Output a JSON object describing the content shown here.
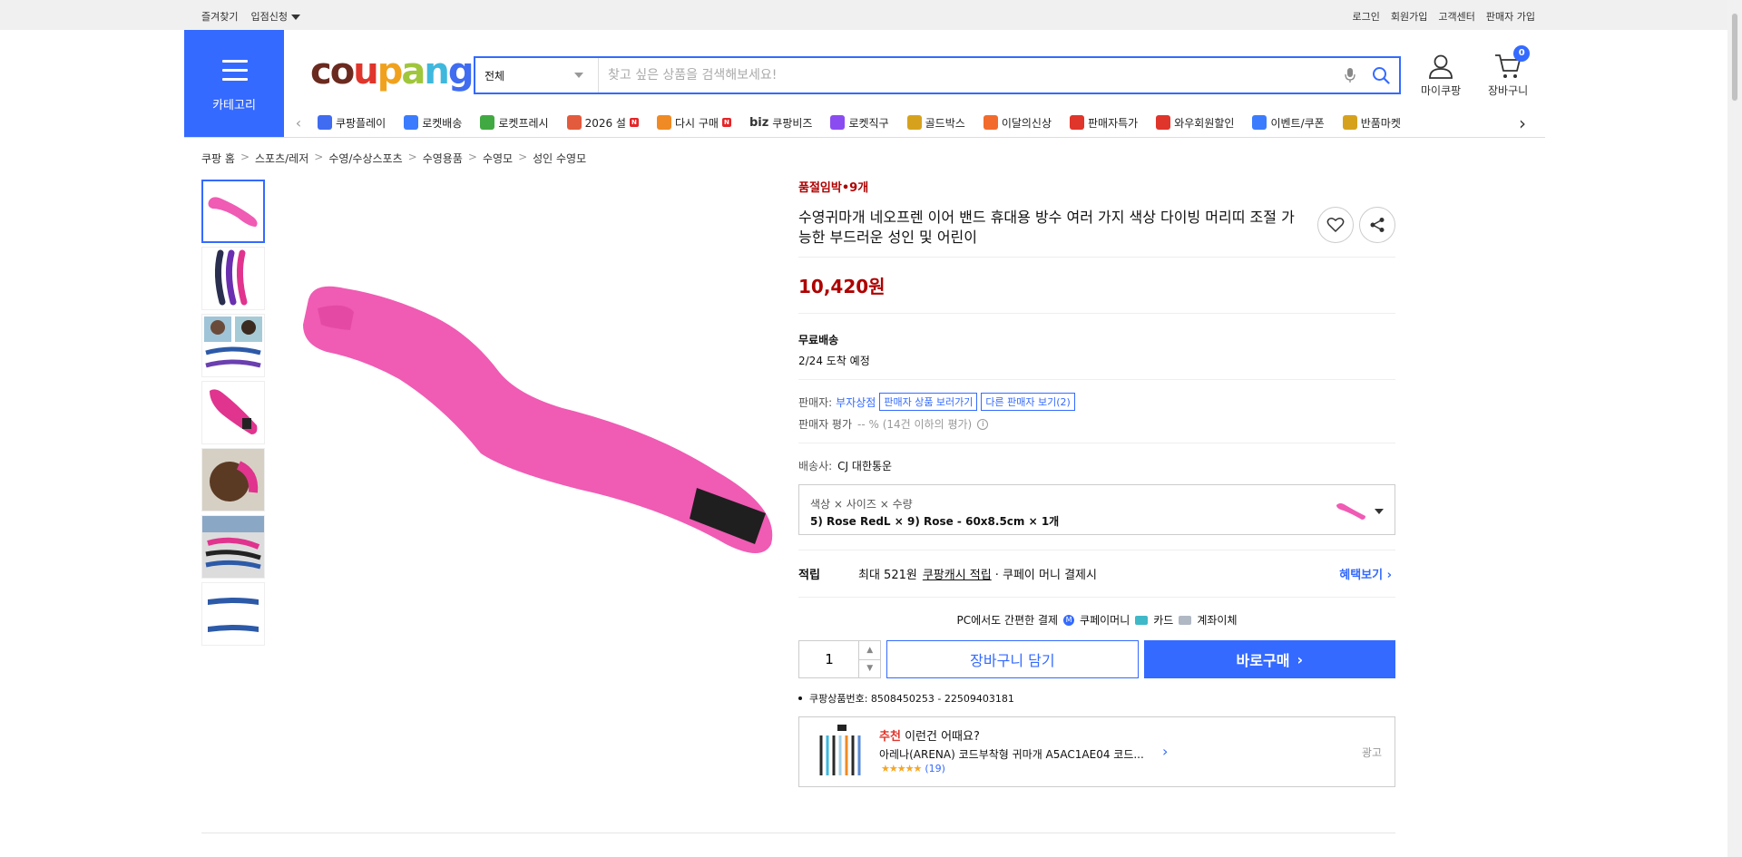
{
  "topbar": {
    "favorites": "즐겨찾기",
    "partner": "입점신청",
    "login": "로그인",
    "signup": "회원가입",
    "customer_center": "고객센터",
    "seller_signup": "판매자 가입"
  },
  "header": {
    "category_label": "카테고리",
    "logo_text": "coupang",
    "search_category": "전체",
    "search_placeholder": "찾고 싶은 상품을 검색해보세요!",
    "my_coupang": "마이쿠팡",
    "cart": "장바구니",
    "cart_count": "0"
  },
  "nav": [
    {
      "label": "쿠팡플레이",
      "color": "#3f6cf0"
    },
    {
      "label": "로켓배송",
      "color": "#3b7cff"
    },
    {
      "label": "로켓프레시",
      "color": "#41a941"
    },
    {
      "label": "2026 설",
      "color": "#e25b3c",
      "badge": "N"
    },
    {
      "label": "다시 구매",
      "color": "#f08a24",
      "badge": "N"
    },
    {
      "label": "쿠팡비즈",
      "prefix": "biz",
      "color": "#333333"
    },
    {
      "label": "로켓직구",
      "color": "#8a4cf0"
    },
    {
      "label": "골드박스",
      "color": "#d6a21e"
    },
    {
      "label": "이달의신상",
      "color": "#f26b2c"
    },
    {
      "label": "판매자특가",
      "color": "#e0352b"
    },
    {
      "label": "와우회원할인",
      "color": "#e0352b"
    },
    {
      "label": "이벤트/쿠폰",
      "color": "#3b7cff"
    },
    {
      "label": "반품마켓",
      "color": "#d6a21e"
    }
  ],
  "breadcrumb": [
    "쿠팡 홈",
    "스포츠/레저",
    "수영/수상스포츠",
    "수영용품",
    "수영모",
    "성인 수영모"
  ],
  "product": {
    "stock_notice": "품절임박•9개",
    "title": "수영귀마개 네오프렌 이어 밴드 휴대용 방수 여러 가지 색상 다이빙 머리띠 조절 가능한 부드러운 성인 및 어린이",
    "price": "10,420원",
    "shipping_title": "무료배송",
    "arrival": "2/24 도착 예정",
    "seller_label": "판매자:",
    "seller_name": "부자상점",
    "seller_products_btn": "판매자 상품 보러가기",
    "other_sellers_btn": "다른 판매자 보기(2)",
    "seller_rating_label": "판매자 평가",
    "seller_rating_value": "-- % (14건 이하의 평가)",
    "courier_label": "배송사:",
    "courier_name": "CJ 대한통운",
    "option_header": "색상 × 사이즈 × 수량",
    "option_value": "5) Rose RedL × 9) Rose - 60x8.5cm × 1개",
    "points_label": "적립",
    "points_text_pre": "최대 521원",
    "points_link": "쿠팡캐시 적립",
    "points_text_post": "· 쿠페이 머니 결제시",
    "benefit_link": "혜택보기",
    "pc_payment": "PC에서도 간편한 결제",
    "pay_money": "쿠페이머니",
    "pay_card": "카드",
    "pay_bank": "계좌이체",
    "quantity": "1",
    "add_to_cart": "장바구니 담기",
    "buy_now": "바로구매",
    "product_code": "쿠팡상품번호: 8508450253 - 22509403181"
  },
  "recommend": {
    "tag": "추천",
    "heading": "이런건 어때요?",
    "item": "아레나(ARENA) 코드부착형 귀마개 A5AC1AE04 코드...",
    "rating_count": "(19)",
    "ad_label": "광고"
  },
  "colors": {
    "brand_blue": "#346aff",
    "price_red": "#ae0000",
    "product_pink": "#f05bb4"
  }
}
